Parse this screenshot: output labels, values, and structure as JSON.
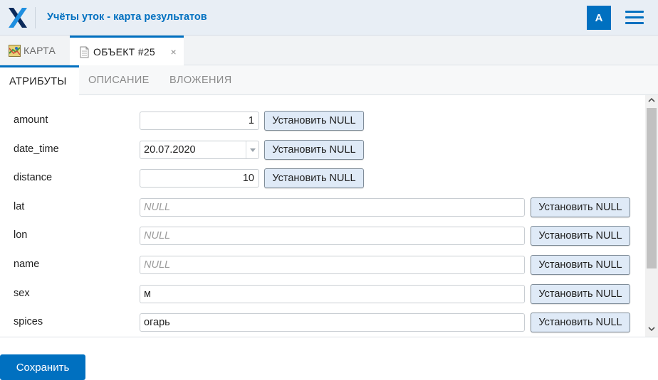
{
  "header": {
    "app_title": "Учёты уток - карта результатов",
    "avatar_letter": "A",
    "logo_icon": "x-logo-icon",
    "menu_icon": "hamburger-menu-icon",
    "accent_color": "#0070c0"
  },
  "doc_tabs": [
    {
      "label": "КАРТА",
      "icon": "map-icon",
      "active": false
    },
    {
      "label": "ОБЪЕКТ #25",
      "icon": "document-icon",
      "active": true,
      "close": "×"
    }
  ],
  "sub_tabs": [
    {
      "label": "АТРИБУТЫ",
      "active": true
    },
    {
      "label": "ОПИСАНИЕ",
      "active": false
    },
    {
      "label": "ВЛОЖЕНИЯ",
      "active": false
    }
  ],
  "attributes": [
    {
      "name": "amount",
      "value": "1",
      "placeholder": "",
      "button": "Установить NULL"
    },
    {
      "name": "date_time",
      "value": "20.07.2020",
      "placeholder": "",
      "button": "Установить NULL"
    },
    {
      "name": "distance",
      "value": "10",
      "placeholder": "",
      "button": "Установить NULL"
    },
    {
      "name": "lat",
      "value": "",
      "placeholder": "NULL",
      "button": "Установить NULL"
    },
    {
      "name": "lon",
      "value": "",
      "placeholder": "NULL",
      "button": "Установить NULL"
    },
    {
      "name": "name",
      "value": "",
      "placeholder": "NULL",
      "button": "Установить NULL"
    },
    {
      "name": "sex",
      "value": "м",
      "placeholder": "",
      "button": "Установить NULL"
    },
    {
      "name": "spices",
      "value": "огарь",
      "placeholder": "",
      "button": "Установить NULL"
    }
  ],
  "save_label": "Сохранить"
}
